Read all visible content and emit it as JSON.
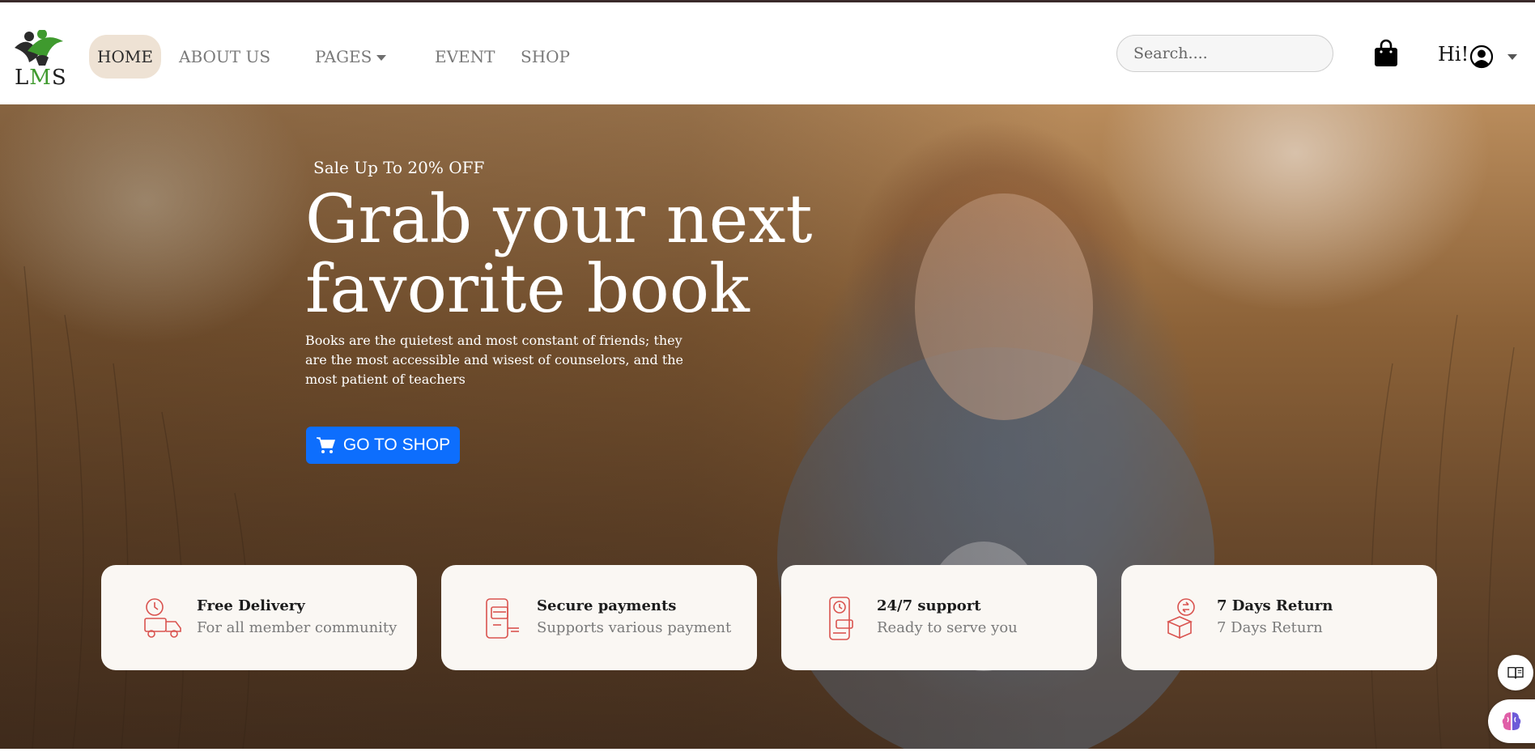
{
  "brand": {
    "logo_text_l": "L",
    "logo_text_m": "M",
    "logo_text_s": "S"
  },
  "nav": {
    "items": [
      {
        "label": "HOME",
        "active": true
      },
      {
        "label": "ABOUT US",
        "active": false
      },
      {
        "label": "PAGES",
        "active": false,
        "dropdown": true
      },
      {
        "label": "EVENT",
        "active": false
      },
      {
        "label": "SHOP",
        "active": false
      }
    ],
    "search_placeholder": "Search....",
    "greeting": "Hi!"
  },
  "hero": {
    "sale": "Sale Up To 20% OFF",
    "headline_line1": "Grab your next",
    "headline_line2": "favorite book",
    "quote": "Books are the quietest and most constant of friends; they are the most accessible and wisest of counselors, and the most patient of teachers",
    "cta_label": "GO TO SHOP"
  },
  "features": [
    {
      "title": "Free Delivery",
      "subtitle": "For all member community",
      "icon": "delivery-truck-icon"
    },
    {
      "title": "Secure payments",
      "subtitle": "Supports various payment",
      "icon": "payment-phone-icon"
    },
    {
      "title": "24/7 support",
      "subtitle": "Ready to serve you",
      "icon": "support-phone-icon"
    },
    {
      "title": "7 Days Return",
      "subtitle": "7 Days Return",
      "icon": "return-box-icon"
    }
  ],
  "colors": {
    "accent": "#0d6efd",
    "active_nav_bg": "#eee2d4",
    "feature_icon": "#d9534f",
    "card_bg": "#faf7f3"
  }
}
